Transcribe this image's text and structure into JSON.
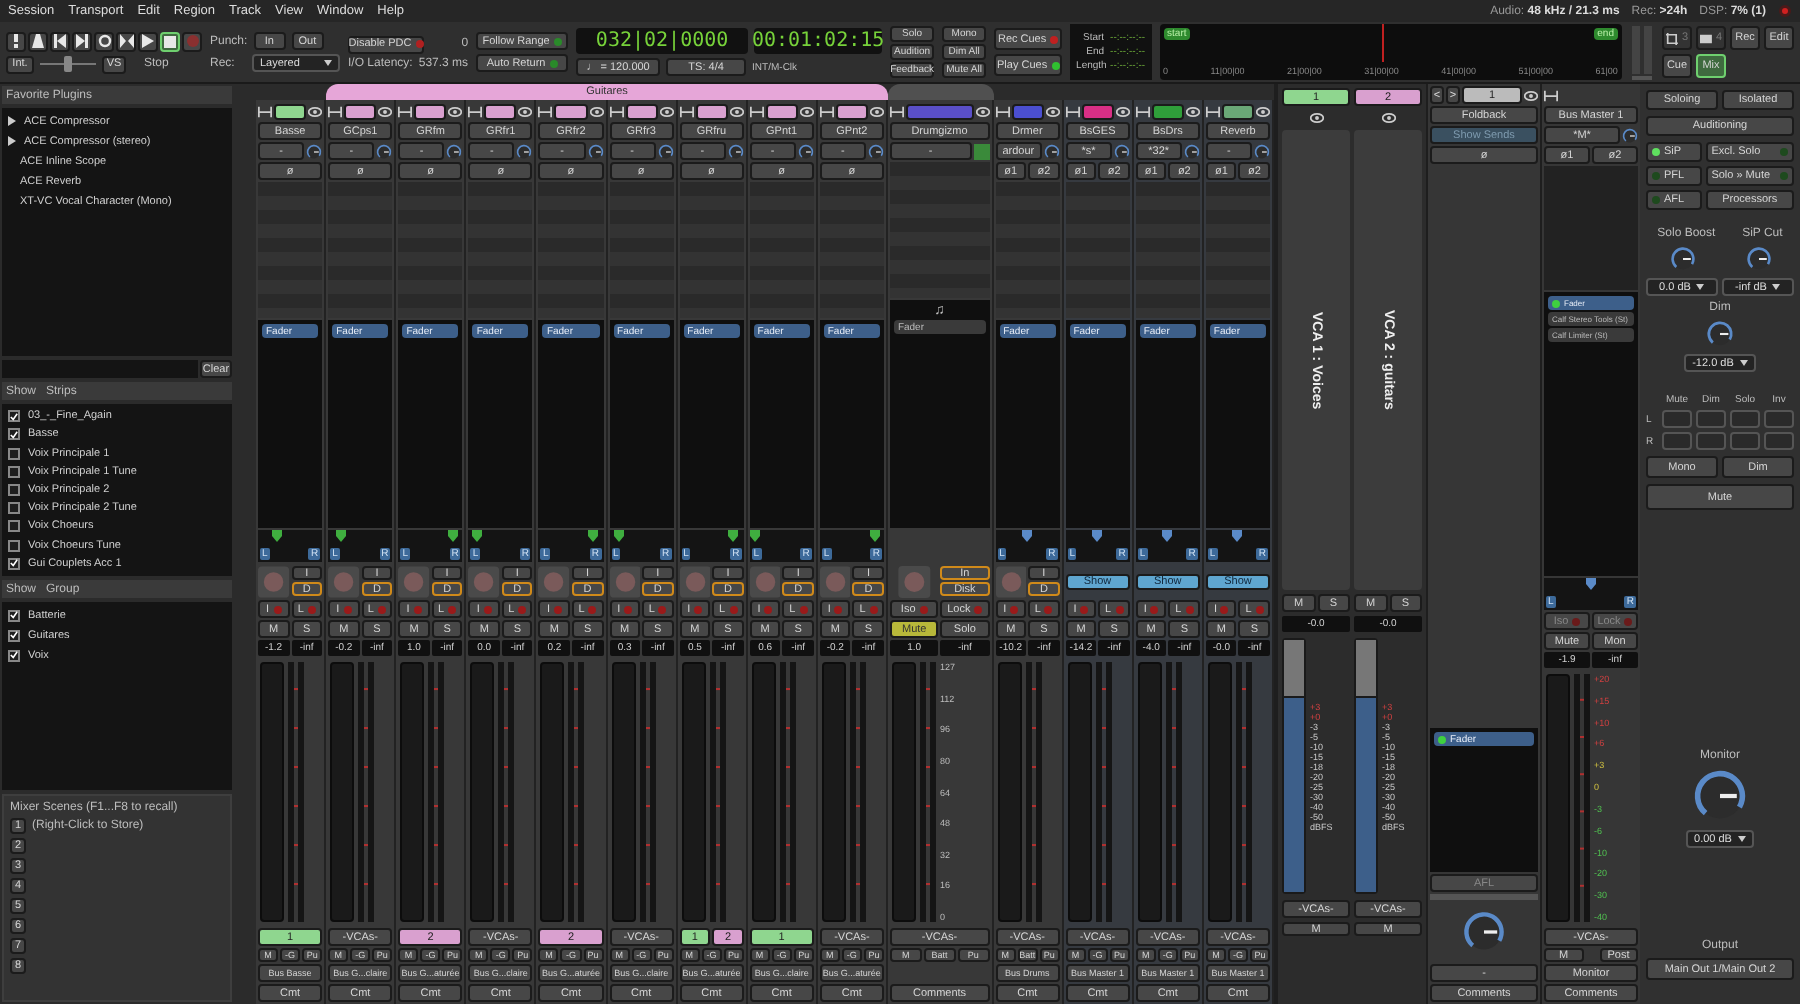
{
  "menu": [
    "Session",
    "Transport",
    "Edit",
    "Region",
    "Track",
    "View",
    "Window",
    "Help"
  ],
  "status": [
    {
      "label": "Audio:",
      "value": "48 kHz / 21.3 ms"
    },
    {
      "label": "Rec:",
      "value": ">24h"
    },
    {
      "label": "DSP:",
      "value": "7% (1)"
    }
  ],
  "transport": {
    "buttons": [
      {
        "kind": "panic",
        "selected": false
      },
      {
        "kind": "metronome",
        "selected": false
      },
      {
        "kind": "start",
        "selected": false
      },
      {
        "kind": "end",
        "selected": false
      },
      {
        "kind": "loop",
        "selected": false
      },
      {
        "kind": "range",
        "selected": false
      },
      {
        "kind": "play",
        "selected": false
      },
      {
        "kind": "stop",
        "selected": true
      },
      {
        "kind": "record",
        "selected": false
      }
    ],
    "shuttle": {
      "level": 0.5
    },
    "int": "Int.",
    "vs": "VS",
    "state": "Stop",
    "punch_label": "Punch:",
    "punch": [
      "In",
      "Out"
    ],
    "rec_label": "Rec:",
    "rec_mode": "Layered",
    "pdc": "Disable PDC",
    "pdc_value": "0",
    "latency_label": "I/O Latency:",
    "latency": "537.3 ms",
    "follow_range": "Follow Range",
    "auto_return": "Auto Return",
    "clock_bbt": "032|02|0000",
    "clock_time": "00:01:02:15",
    "tempo": "♩ = 120.000",
    "meter": "TS: 4/4",
    "sync": "INT/M-Clk",
    "solo_group": [
      "Solo",
      "Audition",
      "Feedback"
    ],
    "mono_group": [
      "Mono",
      "Dim All",
      "Mute All"
    ],
    "cues": [
      {
        "label": "Rec Cues",
        "color": "#c02020"
      },
      {
        "label": "Play Cues",
        "color": "#30c030"
      }
    ],
    "range": [
      {
        "label": "Start",
        "value": "--:--:--:--"
      },
      {
        "label": "End",
        "value": "--:--:--:--"
      },
      {
        "label": "Length",
        "value": "--:--:--:--"
      }
    ],
    "timeline": {
      "start": "start",
      "end": "end",
      "ticks": [
        "0",
        "11|00|00",
        "21|00|00",
        "31|00|00",
        "41|00|00",
        "51|00|00",
        "61|00"
      ]
    },
    "pages": [
      {
        "label": "3",
        "kind": "grid",
        "selected": false
      },
      {
        "label": "4",
        "kind": "battery",
        "selected": false
      },
      {
        "label": "Rec",
        "selected": false
      },
      {
        "label": "Edit",
        "selected": false
      },
      {
        "label": "Cue",
        "selected": false
      },
      {
        "label": "Mix",
        "selected": true
      }
    ]
  },
  "sidebar": {
    "favorites": {
      "title": "Favorite Plugins",
      "items": [
        {
          "label": "ACE Compressor",
          "has_presets": true
        },
        {
          "label": "ACE Compressor (stereo)",
          "has_presets": true
        },
        {
          "label": "ACE Inline Scope",
          "has_presets": false
        },
        {
          "label": "ACE Reverb",
          "has_presets": false
        },
        {
          "label": "XT-VC Vocal Character (Mono)",
          "has_presets": false
        }
      ],
      "clear": "Clear"
    },
    "strips": {
      "show": "Show",
      "title": "Strips",
      "items": [
        {
          "label": "03_-_Fine_Again",
          "checked": true
        },
        {
          "label": "Basse",
          "checked": true
        },
        {
          "label": "Voix Principale 1",
          "checked": false
        },
        {
          "label": "Voix Principale 1 Tune",
          "checked": false
        },
        {
          "label": "Voix Principale 2",
          "checked": false
        },
        {
          "label": "Voix Principale 2 Tune",
          "checked": false
        },
        {
          "label": "Voix Choeurs",
          "checked": false
        },
        {
          "label": "Voix Choeurs Tune",
          "checked": false
        },
        {
          "label": "Gui Couplets Acc 1",
          "checked": true
        }
      ]
    },
    "groups": {
      "show": "Show",
      "title": "Group",
      "items": [
        {
          "label": "Batterie",
          "checked": true
        },
        {
          "label": "Guitares",
          "checked": true
        },
        {
          "label": "Voix",
          "checked": true
        }
      ]
    },
    "scenes": {
      "title": "Mixer Scenes (F1...F8 to recall)",
      "hint": "(Right-Click to Store)",
      "buttons": [
        "1",
        "2",
        "3",
        "4",
        "5",
        "6",
        "7",
        "8"
      ]
    }
  },
  "sections": [
    {
      "strips": [
        {
          "kind": "audio",
          "name": "Basse",
          "color": "#8fd68f",
          "input": "-",
          "phase": [
            "ø"
          ],
          "processors": [
            {
              "label": "Fader",
              "active": true
            }
          ],
          "panner": {
            "level": 0.3,
            "left": "L",
            "right": "R"
          },
          "monitor_buttons": [
            {
              "label": "I",
              "selected": false
            },
            {
              "label": "D",
              "selected": true
            }
          ],
          "safe": [
            "I",
            "L"
          ],
          "mute": {
            "label": "M",
            "on": false
          },
          "solo": {
            "label": "S",
            "on": false
          },
          "gain": "-1.2",
          "peak": "-inf",
          "vcas": [
            {
              "label": "1",
              "color": "#8fd68f"
            }
          ],
          "flags": [
            "M",
            "-G",
            "Pu"
          ],
          "bus": "Bus Basse",
          "comment": "Cmt"
        }
      ]
    },
    {
      "group": {
        "label": "Guitares",
        "color": "#e6a6d8"
      },
      "strips": [
        {
          "kind": "audio",
          "name": "GCps1",
          "color": "#d9a0cf",
          "input": "-",
          "phase": [
            "ø"
          ],
          "processors": [
            {
              "label": "Fader",
              "active": true
            }
          ],
          "panner": {
            "level": 0.2,
            "left": "L",
            "right": "R"
          },
          "monitor_buttons": [
            {
              "label": "I",
              "selected": false
            },
            {
              "label": "D",
              "selected": true
            }
          ],
          "safe": [
            "I",
            "L"
          ],
          "mute": {
            "label": "M",
            "on": false
          },
          "solo": {
            "label": "S",
            "on": false
          },
          "gain": "-0.2",
          "peak": "-inf",
          "vca_label": "-VCAs-",
          "flags": [
            "M",
            "-G",
            "Pu"
          ],
          "bus": "Bus G...claire",
          "comment": "Cmt"
        },
        {
          "kind": "audio",
          "name": "GRfm",
          "color": "#d9a0cf",
          "input": "-",
          "phase": [
            "ø"
          ],
          "processors": [
            {
              "label": "Fader",
              "active": true
            }
          ],
          "panner": {
            "level": 0.85,
            "left": "L",
            "right": "R"
          },
          "monitor_buttons": [
            {
              "label": "I",
              "selected": false
            },
            {
              "label": "D",
              "selected": true
            }
          ],
          "safe": [
            "I",
            "L"
          ],
          "mute": {
            "label": "M",
            "on": false
          },
          "solo": {
            "label": "S",
            "on": false
          },
          "gain": "1.0",
          "peak": "-inf",
          "vcas": [
            {
              "label": "2",
              "color": "#d9a0cf"
            }
          ],
          "flags": [
            "M",
            "-G",
            "Pu"
          ],
          "bus": "Bus G...aturée",
          "comment": "Cmt"
        },
        {
          "kind": "audio",
          "name": "GRfr1",
          "color": "#d9a0cf",
          "input": "-",
          "phase": [
            "ø"
          ],
          "processors": [
            {
              "label": "Fader",
              "active": true
            }
          ],
          "panner": {
            "level": 0.12,
            "left": "L",
            "right": "R"
          },
          "monitor_buttons": [
            {
              "label": "I",
              "selected": false
            },
            {
              "label": "D",
              "selected": true
            }
          ],
          "safe": [
            "I",
            "L"
          ],
          "mute": {
            "label": "M",
            "on": false
          },
          "solo": {
            "label": "S",
            "on": false
          },
          "gain": "0.0",
          "peak": "-inf",
          "vca_label": "-VCAs-",
          "flags": [
            "M",
            "-G",
            "Pu"
          ],
          "bus": "Bus G...claire",
          "comment": "Cmt"
        },
        {
          "kind": "audio",
          "name": "GRfr2",
          "color": "#d9a0cf",
          "input": "-",
          "phase": [
            "ø"
          ],
          "processors": [
            {
              "label": "Fader",
              "active": true
            }
          ],
          "panner": {
            "level": 0.85,
            "left": "L",
            "right": "R"
          },
          "monitor_buttons": [
            {
              "label": "I",
              "selected": false
            },
            {
              "label": "D",
              "selected": true
            }
          ],
          "safe": [
            "I",
            "L"
          ],
          "mute": {
            "label": "M",
            "on": false
          },
          "solo": {
            "label": "S",
            "on": false
          },
          "gain": "0.2",
          "peak": "-inf",
          "vcas": [
            {
              "label": "2",
              "color": "#d9a0cf"
            }
          ],
          "flags": [
            "M",
            "-G",
            "Pu"
          ],
          "bus": "Bus G...aturée",
          "comment": "Cmt"
        },
        {
          "kind": "audio",
          "name": "GRfr3",
          "color": "#d9a0cf",
          "input": "-",
          "phase": [
            "ø"
          ],
          "processors": [
            {
              "label": "Fader",
              "active": true
            }
          ],
          "panner": {
            "level": 0.15,
            "left": "L",
            "right": "R"
          },
          "monitor_buttons": [
            {
              "label": "I",
              "selected": false
            },
            {
              "label": "D",
              "selected": true
            }
          ],
          "safe": [
            "I",
            "L"
          ],
          "mute": {
            "label": "M",
            "on": false
          },
          "solo": {
            "label": "S",
            "on": false
          },
          "gain": "0.3",
          "peak": "-inf",
          "vca_label": "-VCAs-",
          "flags": [
            "M",
            "-G",
            "Pu"
          ],
          "bus": "Bus G...claire",
          "comment": "Cmt"
        },
        {
          "kind": "audio",
          "name": "GRfru",
          "color": "#d9a0cf",
          "input": "-",
          "phase": [
            "ø"
          ],
          "processors": [
            {
              "label": "Fader",
              "active": true
            }
          ],
          "panner": {
            "level": 0.85,
            "left": "L",
            "right": "R"
          },
          "monitor_buttons": [
            {
              "label": "I",
              "selected": false
            },
            {
              "label": "D",
              "selected": true
            }
          ],
          "safe": [
            "I",
            "L"
          ],
          "mute": {
            "label": "M",
            "on": false
          },
          "solo": {
            "label": "S",
            "on": false
          },
          "gain": "0.5",
          "peak": "-inf",
          "vcas": [
            {
              "label": "1",
              "color": "#8fd68f"
            },
            {
              "label": "2",
              "color": "#d9a0cf"
            }
          ],
          "flags": [
            "M",
            "-G",
            "Pu"
          ],
          "bus": "Bus G...aturée",
          "comment": "Cmt"
        },
        {
          "kind": "audio",
          "name": "GPnt1",
          "color": "#d9a0cf",
          "input": "-",
          "phase": [
            "ø"
          ],
          "processors": [
            {
              "label": "Fader",
              "active": true
            }
          ],
          "panner": {
            "level": 0.1,
            "left": "L",
            "right": "R"
          },
          "monitor_buttons": [
            {
              "label": "I",
              "selected": false
            },
            {
              "label": "D",
              "selected": true
            }
          ],
          "safe": [
            "I",
            "L"
          ],
          "mute": {
            "label": "M",
            "on": false
          },
          "solo": {
            "label": "S",
            "on": false
          },
          "gain": "0.6",
          "peak": "-inf",
          "vcas": [
            {
              "label": "1",
              "color": "#8fd68f"
            }
          ],
          "flags": [
            "M",
            "-G",
            "Pu"
          ],
          "bus": "Bus G...claire",
          "comment": "Cmt"
        },
        {
          "kind": "audio",
          "name": "GPnt2",
          "color": "#d9a0cf",
          "input": "-",
          "phase": [
            "ø"
          ],
          "processors": [
            {
              "label": "Fader",
              "active": true
            }
          ],
          "panner": {
            "level": 0.85,
            "left": "L",
            "right": "R"
          },
          "monitor_buttons": [
            {
              "label": "I",
              "selected": false
            },
            {
              "label": "D",
              "selected": true
            }
          ],
          "safe": [
            "I",
            "L"
          ],
          "mute": {
            "label": "M",
            "on": false
          },
          "solo": {
            "label": "S",
            "on": false
          },
          "gain": "-0.2",
          "peak": "-inf",
          "vca_label": "-VCAs-",
          "flags": [
            "M",
            "-G",
            "Pu"
          ],
          "bus": "Bus G...aturée",
          "comment": "Cmt"
        }
      ]
    },
    {
      "group": {
        "color": "#505050"
      },
      "strips": [
        {
          "kind": "midi",
          "name": "Drumgizmo",
          "color": "#5a4fc8",
          "input": "-",
          "note": "♫",
          "processors": [
            {
              "label": "Fader",
              "active": false
            }
          ],
          "monitor_buttons": [
            {
              "label": "In",
              "selected": true
            },
            {
              "label": "Disk",
              "selected": true
            }
          ],
          "safe": [
            "Iso",
            "Lock"
          ],
          "mute": {
            "label": "Mute",
            "on": true
          },
          "solo": {
            "label": "Solo",
            "on": false
          },
          "gain": "1.0",
          "peak": "-inf",
          "scale": [
            "127",
            "112",
            "96",
            "80",
            "64",
            "48",
            "32",
            "16",
            "0"
          ],
          "vca_label": "-VCAs-",
          "flags": [
            "M",
            "Batt",
            "Pu"
          ],
          "comment": "Comments"
        }
      ]
    },
    {
      "strips": [
        {
          "kind": "audio",
          "name": "Drmer",
          "color": "#4b4fd0",
          "input": "ardour",
          "phase": [
            "ø1",
            "ø2"
          ],
          "processors": [
            {
              "label": "Fader",
              "active": true
            }
          ],
          "panner": {
            "level": 0.5,
            "left": "L",
            "right": "R"
          },
          "monitor_buttons": [
            {
              "label": "I",
              "selected": false
            },
            {
              "label": "D",
              "selected": true
            }
          ],
          "safe": [
            "I",
            "L"
          ],
          "mute": {
            "label": "M",
            "on": false
          },
          "solo": {
            "label": "S",
            "on": false
          },
          "gain": "-10.2",
          "peak": "-inf",
          "vca_label": "-VCAs-",
          "flags": [
            "M",
            "Batt",
            "Pu"
          ],
          "bus": "Bus Drums",
          "comment": "Cmt"
        },
        {
          "kind": "bus",
          "name": "BsGES",
          "color": "#d92f86",
          "input": "*s*",
          "phase": [
            "ø1",
            "ø2"
          ],
          "processors": [
            {
              "label": "Fader",
              "active": true
            }
          ],
          "panner": {
            "level": 0.5,
            "left": "L",
            "right": "R"
          },
          "show": "Show",
          "safe": [
            "I",
            "L"
          ],
          "mute": {
            "label": "M",
            "on": false
          },
          "solo": {
            "label": "S",
            "on": false
          },
          "gain": "-14.2",
          "peak": "-inf",
          "vca_label": "-VCAs-",
          "flags": [
            "M",
            "-G",
            "Pu"
          ],
          "bus": "Bus Master 1",
          "comment": "Cmt"
        },
        {
          "kind": "bus",
          "name": "BsDrs",
          "color": "#2f9e3a",
          "input": "*32*",
          "phase": [
            "ø1",
            "ø2"
          ],
          "processors": [
            {
              "label": "Fader",
              "active": true
            }
          ],
          "panner": {
            "level": 0.5,
            "left": "L",
            "right": "R"
          },
          "show": "Show",
          "safe": [
            "I",
            "L"
          ],
          "mute": {
            "label": "M",
            "on": false
          },
          "solo": {
            "label": "S",
            "on": false
          },
          "gain": "-4.0",
          "peak": "-inf",
          "vca_label": "-VCAs-",
          "flags": [
            "M",
            "-G",
            "Pu"
          ],
          "bus": "Bus Master 1",
          "comment": "Cmt"
        },
        {
          "kind": "bus",
          "name": "Reverb",
          "color": "#6aa877",
          "input": "-",
          "phase": [
            "ø1",
            "ø2"
          ],
          "processors": [
            {
              "label": "Fader",
              "active": true
            }
          ],
          "panner": {
            "level": 0.5,
            "left": "L",
            "right": "R"
          },
          "show": "Show",
          "safe": [
            "I",
            "L"
          ],
          "mute": {
            "label": "M",
            "on": false
          },
          "solo": {
            "label": "S",
            "on": false
          },
          "gain": "-0.0",
          "peak": "-inf",
          "vca_label": "-VCAs-",
          "flags": [
            "M",
            "-G",
            "Pu"
          ],
          "bus": "Bus Master 1",
          "comment": "Cmt"
        }
      ]
    }
  ],
  "vcas": [
    {
      "number": "1",
      "color": "#8fd68f",
      "name": "VCA 1 : Voices",
      "mute": "M",
      "solo": "S",
      "gain": "-0.0",
      "scale": [
        "+3",
        "+0",
        "-3",
        "-5",
        "-10",
        "-15",
        "-18",
        "-20",
        "-25",
        "-30",
        "-40",
        "-50",
        "dBFS"
      ],
      "vca_label": "-VCAs-",
      "flag": "M"
    },
    {
      "number": "2",
      "color": "#d9a0cf",
      "name": "VCA 2 : guitars",
      "mute": "M",
      "solo": "S",
      "gain": "-0.0",
      "scale": [
        "+3",
        "+0",
        "-3",
        "-5",
        "-10",
        "-15",
        "-18",
        "-20",
        "-25",
        "-30",
        "-40",
        "-50",
        "dBFS"
      ],
      "vca_label": "-VCAs-",
      "flag": "M"
    }
  ],
  "foldback": {
    "prev": "<",
    "next": ">",
    "number": "1",
    "name": "Foldback",
    "show_sends": "Show Sends",
    "phase": "ø",
    "processor": "Fader",
    "afl": "AFL",
    "output": "-",
    "comment": "Comments"
  },
  "master": {
    "name": "Bus Master 1",
    "input": "*M*",
    "phase": [
      "ø1",
      "ø2"
    ],
    "processors": [
      {
        "label": "Fader",
        "active": true
      },
      {
        "label": "Calf Stereo Tools (St)",
        "active": false
      },
      {
        "label": "Calf Limiter (St)",
        "active": false
      }
    ],
    "panner": {
      "level": 0.5,
      "left": "L",
      "right": "R"
    },
    "safe": [
      "Iso",
      "Lock"
    ],
    "mute": "Mute",
    "mon": "Mon",
    "gain": "-1.9",
    "peak": "-inf",
    "scale": [
      "+20",
      "+15",
      "+10",
      "+6",
      "+3",
      "0",
      "-3",
      "-6",
      "-10",
      "-20",
      "-30",
      "-40"
    ],
    "vca_label": "-VCAs-",
    "flags": [
      "M",
      "Post"
    ],
    "output": "Monitor",
    "comment": "Comments"
  },
  "monitor": {
    "top": [
      "Soloing",
      "Isolated"
    ],
    "auditioning": "Auditioning",
    "modes": [
      {
        "label": "SiP",
        "on": true
      },
      {
        "label": "Excl. Solo",
        "on": false
      },
      {
        "label": "PFL",
        "on": false
      },
      {
        "label": "Solo » Mute",
        "on": false
      },
      {
        "label": "AFL",
        "on": false
      }
    ],
    "processors": "Processors",
    "solo_boost": "Solo Boost",
    "sip_cut": "SiP Cut",
    "boost_value": "0.0 dB",
    "cut_value": "-inf dB",
    "dim": "Dim",
    "dim_value": "-12.0 dB",
    "matrix_cols": [
      "Mute",
      "Dim",
      "Solo",
      "Inv"
    ],
    "matrix_rows": [
      {
        "label": "L",
        "cells": [
          false,
          false,
          false,
          false
        ]
      },
      {
        "label": "R",
        "cells": [
          false,
          false,
          false,
          false
        ]
      }
    ],
    "mono": "Mono",
    "dim_button": "Dim",
    "mute": "Mute",
    "level_label": "Monitor",
    "level_value": "0.00 dB",
    "output_label": "Output",
    "output": "Main Out 1/Main Out 2"
  }
}
